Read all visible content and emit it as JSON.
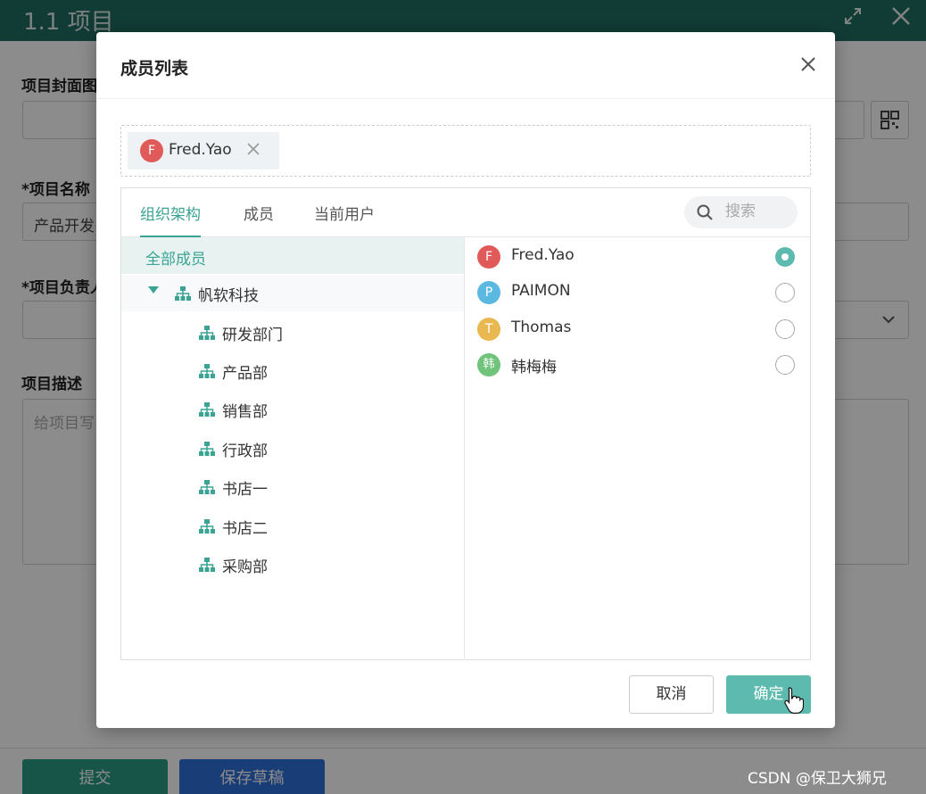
{
  "page": {
    "title": "1.1 项目",
    "icons": {
      "expand": "expand-icon",
      "close": "close-icon"
    },
    "fields": {
      "cover_label": "项目封面图",
      "name_label": "*项目名称",
      "name_value": "产品开发",
      "owner_label": "*项目负责人",
      "desc_label": "项目描述",
      "desc_placeholder": "给项目写"
    },
    "buttons": {
      "submit": "提交",
      "save_draft": "保存草稿"
    },
    "watermark": "CSDN @保卫大狮兄"
  },
  "dialog": {
    "title": "成员列表",
    "close_icon": "close-icon",
    "selected": [
      {
        "initial": "F",
        "name": "Fred.Yao",
        "color": "#e05a5a"
      }
    ],
    "tabs": [
      {
        "label": "组织架构",
        "active": true
      },
      {
        "label": "成员",
        "active": false
      },
      {
        "label": "当前用户",
        "active": false
      }
    ],
    "search_placeholder": "搜索",
    "tree": {
      "all_label": "全部成员",
      "root": {
        "label": "帆软科技",
        "expanded": true
      },
      "children": [
        "研发部门",
        "产品部",
        "销售部",
        "行政部",
        "书店一",
        "书店二",
        "采购部"
      ]
    },
    "members": [
      {
        "initial": "F",
        "name": "Fred.Yao",
        "color": "#e05a5a",
        "checked": true
      },
      {
        "initial": "P",
        "name": "PAIMON",
        "color": "#5bb8e0",
        "checked": false
      },
      {
        "initial": "T",
        "name": "Thomas",
        "color": "#eab850",
        "checked": false
      },
      {
        "initial": "韩",
        "name": "韩梅梅",
        "color": "#6fc37a",
        "checked": false
      }
    ],
    "buttons": {
      "cancel": "取消",
      "ok": "确定"
    }
  },
  "colors": {
    "accent": "#3aa393",
    "header": "#1f6e62",
    "primary_button": "#5dbaae"
  }
}
